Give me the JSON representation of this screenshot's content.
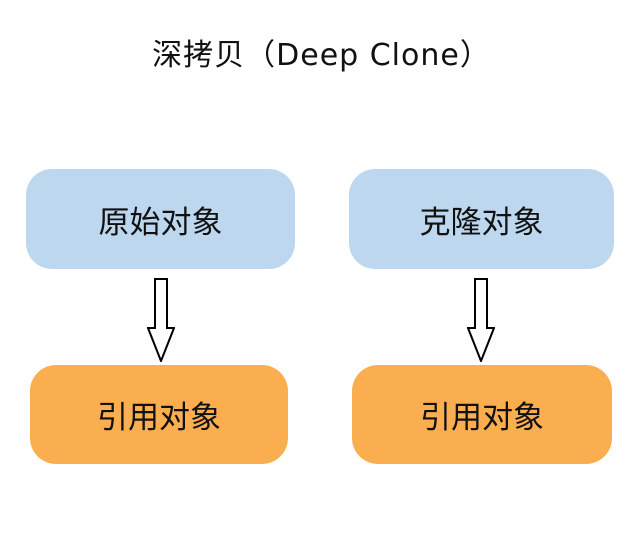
{
  "diagram": {
    "title": "深拷贝（Deep Clone）",
    "left": {
      "source_label": "原始对象",
      "target_label": "引用对象"
    },
    "right": {
      "source_label": "克隆对象",
      "target_label": "引用对象"
    },
    "colors": {
      "source_fill": "#bdd7ee",
      "target_fill": "#fbae4f",
      "arrow_stroke": "#000000"
    },
    "icons": [
      "down-arrow-icon",
      "down-arrow-icon"
    ]
  }
}
